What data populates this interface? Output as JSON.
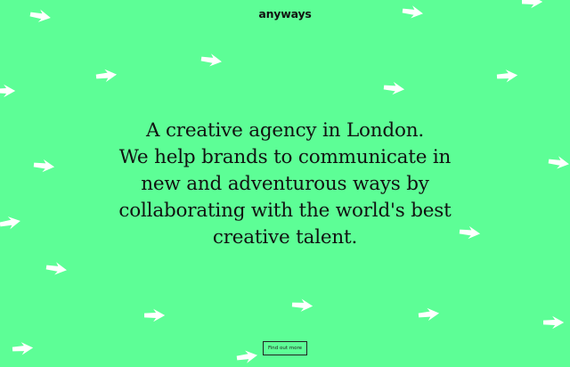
{
  "logo": "anyways",
  "headline": {
    "lines": [
      "A creative agency in London.",
      "We help brands to communicate in",
      "new and adventurous ways by",
      "collaborating with the world's best",
      "creative talent."
    ]
  },
  "cta_label": "Find out more",
  "colors": {
    "background": "#5dfe96",
    "text": "#111111",
    "decoration": "#ffffff"
  },
  "decoration_icon": "white-arrow-icon"
}
